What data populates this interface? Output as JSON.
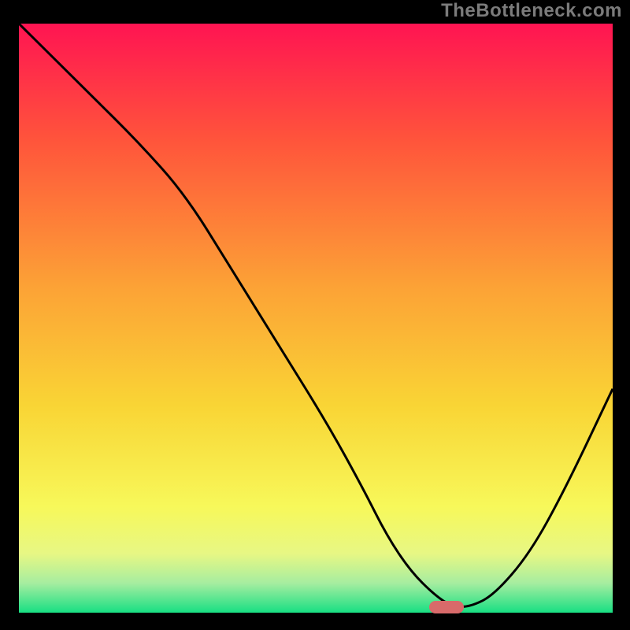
{
  "watermark": "TheBottleneck.com",
  "chart_data": {
    "type": "line",
    "title": "",
    "xlabel": "",
    "ylabel": "",
    "xlim": [
      0,
      100
    ],
    "ylim": [
      0,
      100
    ],
    "grid": false,
    "legend": false,
    "background": {
      "type": "vertical-gradient",
      "stops": [
        {
          "pos": 0.0,
          "color": "#ff1452"
        },
        {
          "pos": 0.2,
          "color": "#ff553b"
        },
        {
          "pos": 0.45,
          "color": "#fca336"
        },
        {
          "pos": 0.65,
          "color": "#f9d535"
        },
        {
          "pos": 0.82,
          "color": "#f7f85a"
        },
        {
          "pos": 0.9,
          "color": "#e7f784"
        },
        {
          "pos": 0.95,
          "color": "#a6eda0"
        },
        {
          "pos": 1.0,
          "color": "#18df83"
        }
      ]
    },
    "series": [
      {
        "name": "bottleneck-curve",
        "color": "#000000",
        "x": [
          0,
          6,
          12,
          20,
          28,
          36,
          44,
          52,
          58,
          62,
          66,
          70,
          73,
          76,
          80,
          86,
          92,
          100
        ],
        "y": [
          100,
          94,
          88,
          80,
          71,
          58,
          45,
          32,
          21,
          13,
          7,
          3,
          1,
          1,
          3,
          10,
          21,
          38
        ]
      }
    ],
    "marker": {
      "name": "optimal-point",
      "x": 72,
      "y": 1,
      "color": "#d86a6a",
      "shape": "rounded-bar"
    }
  }
}
